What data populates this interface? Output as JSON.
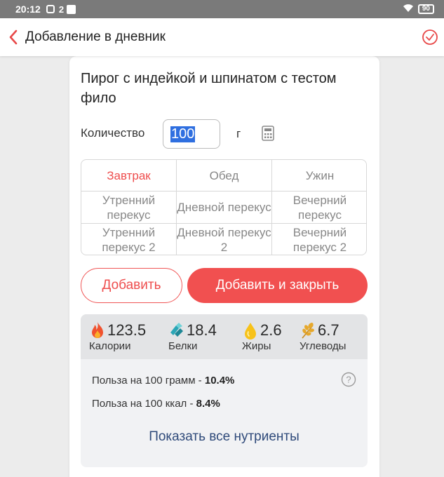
{
  "status_bar": {
    "time": "20:12",
    "notif_count": "2",
    "battery": "90"
  },
  "header": {
    "title": "Добавление в дневник"
  },
  "product": {
    "name": "Пирог с индейкой и шпинатом с тестом фило"
  },
  "quantity": {
    "label": "Количество",
    "value": "100",
    "unit": "г"
  },
  "meals": [
    {
      "label": "Завтрак",
      "selected": true
    },
    {
      "label": "Обед",
      "selected": false
    },
    {
      "label": "Ужин",
      "selected": false
    },
    {
      "label": "Утренний перекус",
      "selected": false
    },
    {
      "label": "Дневной перекус",
      "selected": false
    },
    {
      "label": "Вечерний перекус",
      "selected": false
    },
    {
      "label": "Утренний перекус 2",
      "selected": false
    },
    {
      "label": "Дневной перекус 2",
      "selected": false
    },
    {
      "label": "Вечерний перекус 2",
      "selected": false
    }
  ],
  "buttons": {
    "add": "Добавить",
    "add_close": "Добавить и закрыть"
  },
  "nutrients": {
    "calories": {
      "value": "123.5",
      "label": "Калории",
      "icon": "flame-icon"
    },
    "protein": {
      "value": "18.4",
      "label": "Белки",
      "icon": "protein-icon"
    },
    "fat": {
      "value": "2.6",
      "label": "Жиры",
      "icon": "drop-icon"
    },
    "carbs": {
      "value": "6.7",
      "label": "Углеводы",
      "icon": "wheat-icon"
    }
  },
  "benefit": {
    "per_100g_label": "Польза на 100 грамм - ",
    "per_100g_value": "10.4%",
    "per_100kcal_label": "Польза на 100 ккал - ",
    "per_100kcal_value": "8.4%"
  },
  "show_all": "Показать все нутриенты",
  "colors": {
    "accent": "#F15050",
    "link": "#2F4A7A"
  }
}
